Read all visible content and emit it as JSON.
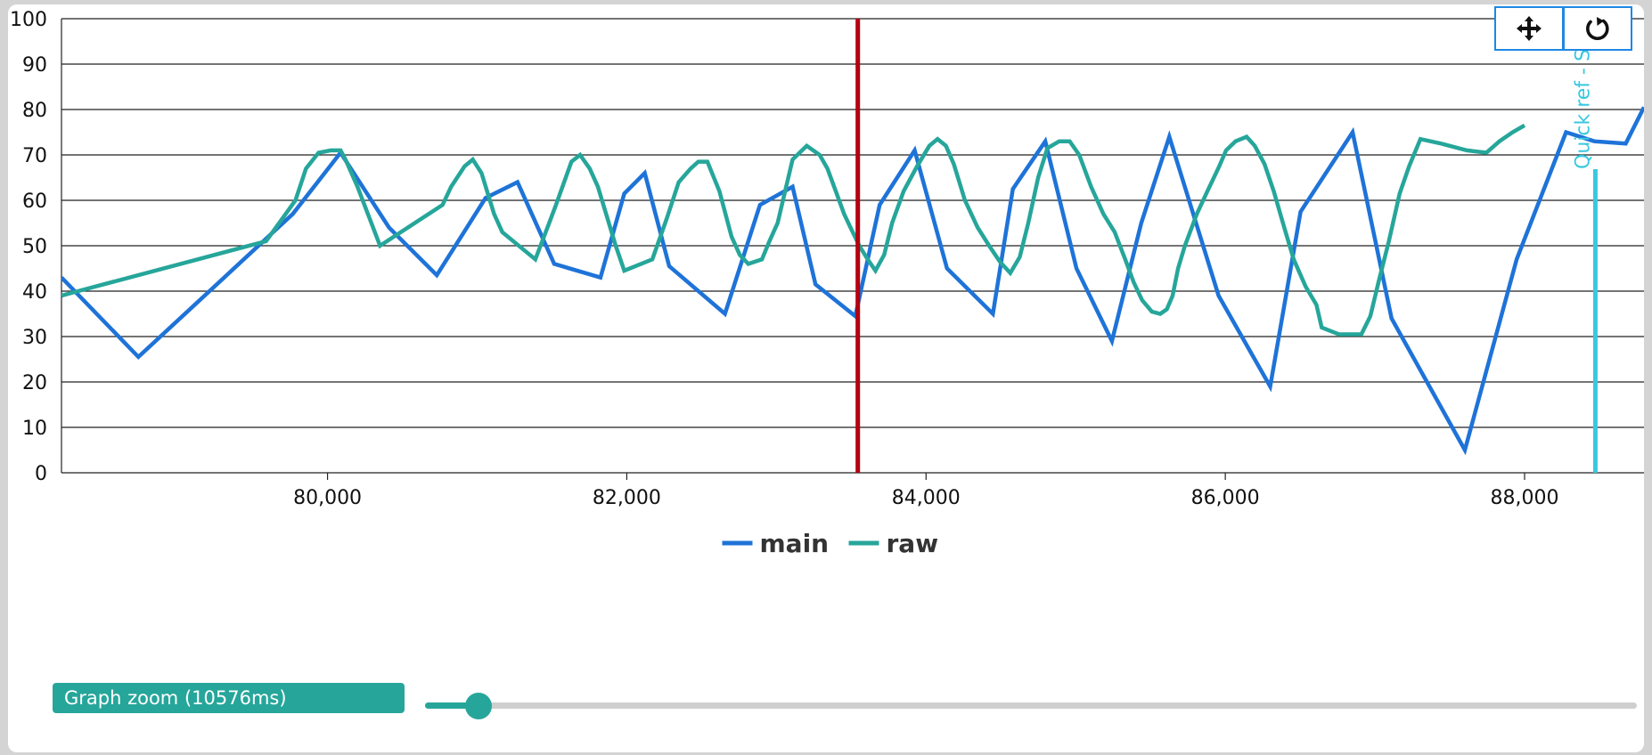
{
  "chart_data": {
    "type": "line",
    "xlim": [
      78222,
      88798
    ],
    "ylim": [
      0,
      100
    ],
    "xticks": [
      80000,
      82000,
      84000,
      86000,
      88000
    ],
    "xtick_labels": [
      "80,000",
      "82,000",
      "84,000",
      "86,000",
      "88,000"
    ],
    "yticks": [
      0,
      10,
      20,
      30,
      40,
      50,
      60,
      70,
      80,
      90,
      100
    ],
    "ytick_labels": [
      "0",
      "10",
      "20",
      "30",
      "40",
      "50",
      "60",
      "70",
      "80",
      "90",
      "100"
    ],
    "grid": true,
    "legend_position": "bottom",
    "series": [
      {
        "name": "main",
        "color": "#1e73d8",
        "points": [
          [
            78222,
            43
          ],
          [
            78736,
            25.5
          ],
          [
            79768,
            57
          ],
          [
            80087,
            70.5
          ],
          [
            80411,
            54
          ],
          [
            80730,
            43.5
          ],
          [
            81056,
            60.5
          ],
          [
            81270,
            64
          ],
          [
            81515,
            46
          ],
          [
            81824,
            43
          ],
          [
            81983,
            61.5
          ],
          [
            82120,
            66
          ],
          [
            82283,
            45.5
          ],
          [
            82656,
            35
          ],
          [
            82890,
            59
          ],
          [
            83108,
            63
          ],
          [
            83261,
            41.5
          ],
          [
            83527,
            34.5
          ],
          [
            83690,
            59
          ],
          [
            83924,
            71
          ],
          [
            84140,
            45
          ],
          [
            84447,
            35
          ],
          [
            84580,
            62.5
          ],
          [
            84797,
            73
          ],
          [
            85005,
            45
          ],
          [
            85242,
            29
          ],
          [
            85438,
            55
          ],
          [
            85626,
            74
          ],
          [
            85955,
            39
          ],
          [
            86300,
            19
          ],
          [
            86503,
            57.5
          ],
          [
            86851,
            75
          ],
          [
            87111,
            34
          ],
          [
            87601,
            5
          ],
          [
            87947,
            47
          ],
          [
            88277,
            75
          ],
          [
            88466,
            73
          ],
          [
            88676,
            72.5
          ],
          [
            88798,
            80.5
          ]
        ]
      },
      {
        "name": "raw",
        "color": "#26a69a",
        "points": [
          [
            78222,
            39
          ],
          [
            78333,
            40
          ],
          [
            79589,
            51
          ],
          [
            79720,
            57
          ],
          [
            79786,
            60
          ],
          [
            79856,
            67
          ],
          [
            79940,
            70.5
          ],
          [
            80022,
            71
          ],
          [
            80087,
            71
          ],
          [
            80120,
            69
          ],
          [
            80200,
            63
          ],
          [
            80351,
            50
          ],
          [
            80769,
            59
          ],
          [
            80826,
            63
          ],
          [
            80916,
            67.5
          ],
          [
            80971,
            69
          ],
          [
            81029,
            66
          ],
          [
            81113,
            57
          ],
          [
            81168,
            53
          ],
          [
            81389,
            47
          ],
          [
            81470,
            54
          ],
          [
            81527,
            59
          ],
          [
            81630,
            68.5
          ],
          [
            81688,
            70
          ],
          [
            81752,
            67
          ],
          [
            81807,
            63
          ],
          [
            81926,
            50
          ],
          [
            81983,
            44.5
          ],
          [
            82171,
            47
          ],
          [
            82267,
            56
          ],
          [
            82347,
            64
          ],
          [
            82427,
            67
          ],
          [
            82478,
            68.5
          ],
          [
            82539,
            68.5
          ],
          [
            82619,
            62
          ],
          [
            82700,
            52
          ],
          [
            82755,
            48
          ],
          [
            82812,
            46
          ],
          [
            82903,
            47
          ],
          [
            82953,
            51
          ],
          [
            83008,
            55
          ],
          [
            83108,
            69
          ],
          [
            83203,
            72
          ],
          [
            83289,
            70
          ],
          [
            83341,
            67
          ],
          [
            83397,
            62
          ],
          [
            83452,
            57
          ],
          [
            83495,
            54
          ],
          [
            83554,
            50
          ],
          [
            83610,
            47
          ],
          [
            83662,
            44.5
          ],
          [
            83720,
            48
          ],
          [
            83773,
            55
          ],
          [
            83850,
            62
          ],
          [
            83940,
            67.5
          ],
          [
            84022,
            72
          ],
          [
            84077,
            73.5
          ],
          [
            84133,
            72
          ],
          [
            84185,
            68
          ],
          [
            84260,
            60
          ],
          [
            84345,
            54
          ],
          [
            84422,
            50
          ],
          [
            84493,
            46.5
          ],
          [
            84563,
            44
          ],
          [
            84626,
            47.5
          ],
          [
            84683,
            55
          ],
          [
            84749,
            65
          ],
          [
            84811,
            71.5
          ],
          [
            84890,
            73
          ],
          [
            84960,
            73
          ],
          [
            85024,
            70
          ],
          [
            85103,
            63
          ],
          [
            85185,
            57
          ],
          [
            85261,
            53
          ],
          [
            85331,
            47
          ],
          [
            85387,
            42
          ],
          [
            85444,
            38
          ],
          [
            85509,
            35.5
          ],
          [
            85565,
            35
          ],
          [
            85609,
            36
          ],
          [
            85648,
            39
          ],
          [
            85684,
            45
          ],
          [
            85730,
            50
          ],
          [
            85810,
            57
          ],
          [
            85880,
            62
          ],
          [
            85959,
            67.5
          ],
          [
            86005,
            71
          ],
          [
            86068,
            73
          ],
          [
            86142,
            74
          ],
          [
            86197,
            72
          ],
          [
            86262,
            68
          ],
          [
            86324,
            62
          ],
          [
            86394,
            54
          ],
          [
            86457,
            47
          ],
          [
            86537,
            41
          ],
          [
            86609,
            37
          ],
          [
            86644,
            32
          ],
          [
            86759,
            30.5
          ],
          [
            86909,
            30.5
          ],
          [
            86969,
            34.5
          ],
          [
            87024,
            42
          ],
          [
            87093,
            51
          ],
          [
            87165,
            61.5
          ],
          [
            87228,
            67.5
          ],
          [
            87304,
            73.5
          ],
          [
            87443,
            72.5
          ],
          [
            87615,
            71
          ],
          [
            87745,
            70.5
          ],
          [
            87832,
            73
          ],
          [
            87920,
            75
          ],
          [
            88000,
            76.5
          ]
        ]
      }
    ],
    "vertical_markers": [
      {
        "x": 83544,
        "color": "#b3000f"
      },
      {
        "x": 88473,
        "color": "#38c8e0",
        "label": "Quick ref - St"
      }
    ]
  },
  "zoom": {
    "label": "Graph zoom (10576ms)",
    "fraction": 0.044
  },
  "controls": {
    "pan_icon": "move-arrows-icon",
    "reset_icon": "refresh-icon",
    "accent": "#1e88e5"
  }
}
